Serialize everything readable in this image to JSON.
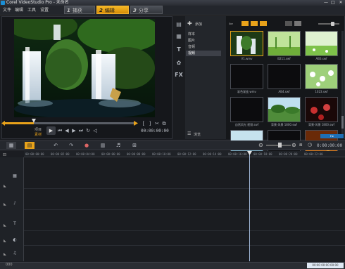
{
  "window": {
    "title": "Corel VideoStudio Pro - 未命名",
    "min_label": "—",
    "max_label": "□",
    "close_label": "✕"
  },
  "menu": {
    "items": [
      "文件",
      "编辑",
      "工具",
      "设置"
    ]
  },
  "steps": [
    {
      "num": "1",
      "label": "捕获"
    },
    {
      "num": "2",
      "label": "编辑"
    },
    {
      "num": "3",
      "label": "分享"
    }
  ],
  "player": {
    "project_label": "项目",
    "clip_label": "素材",
    "timecode": "00:00:00:00"
  },
  "library": {
    "add_label": "添加",
    "folders": [
      "样本",
      "图片",
      "音频",
      "视频"
    ],
    "selected_folder": "视频",
    "options_label": "浏览",
    "category_icon_labels": [
      "T",
      "FX"
    ],
    "thumbs": [
      {
        "label": "V1.wmv",
        "scene": "waterfall"
      },
      {
        "label": "B211.swf",
        "scene": "green"
      },
      {
        "label": "AB3.swf",
        "scene": "field"
      },
      {
        "label": "彩色渐变.wmv",
        "scene": "dark"
      },
      {
        "label": "AB4.swf",
        "scene": "dark"
      },
      {
        "label": "1023.swf",
        "scene": "flowers"
      },
      {
        "label": "自然风光 视频.swf",
        "scene": "dark"
      },
      {
        "label": "背景-风景 1800.swf",
        "scene": "landscape"
      },
      {
        "label": "背景-风景 1800.swf",
        "scene": "red"
      },
      {
        "label": "背景-风景 1800.swf",
        "scene": "lake"
      },
      {
        "label": "黑色背景.swf",
        "scene": "dark"
      },
      {
        "label": "草原.wmv",
        "scene": "orange"
      }
    ]
  },
  "timeline": {
    "timecode": "0:00:00:00",
    "ruler": [
      "00:00:00:00",
      "00:00:02:00",
      "00:00:04:00",
      "00:00:06:00",
      "00:00:08:00",
      "00:00:10:00",
      "00:00:12:00",
      "00:00:14:00",
      "00:00:16:00",
      "00:00:18:00",
      "00:00:20:00",
      "00:00:22:00"
    ],
    "track_icons": [
      "▦",
      "♪",
      "T",
      "◐",
      "♫"
    ]
  },
  "status": {
    "left": "000",
    "right": [
      "00:00",
      "00:00",
      "00:00"
    ]
  }
}
